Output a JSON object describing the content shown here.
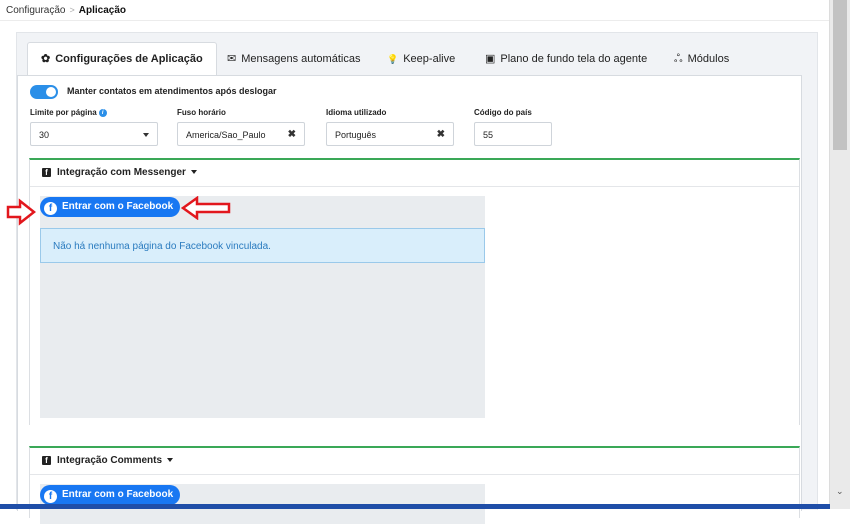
{
  "breadcrumb": {
    "parent": "Configuração",
    "current": "Aplicação"
  },
  "tabs": [
    {
      "label": "Configurações de Aplicação",
      "icon": "gear-icon",
      "glyph": "✿",
      "active": true
    },
    {
      "label": "Mensagens automáticas",
      "icon": "envelope-icon",
      "glyph": "✉"
    },
    {
      "label": "Keep-alive",
      "icon": "lightbulb-icon",
      "glyph": "💡"
    },
    {
      "label": "Plano de fundo tela do agente",
      "icon": "image-icon",
      "glyph": "▣"
    },
    {
      "label": "Módulos",
      "icon": "modules-icon",
      "glyph": "ஃ"
    }
  ],
  "settings": {
    "keep_contacts_label": "Manter contatos em atendimentos após deslogar",
    "keep_contacts_on": true,
    "page_limit": {
      "label": "Limite por página",
      "value": "30"
    },
    "timezone": {
      "label": "Fuso horário",
      "value": "America/Sao_Paulo"
    },
    "language": {
      "label": "Idioma utilizado",
      "value": "Português"
    },
    "country_code": {
      "label": "Código do país",
      "value": "55"
    }
  },
  "messenger": {
    "title": "Integração com Messenger",
    "login_button": "Entrar com o Facebook",
    "empty_message": "Não há nenhuma página do Facebook vinculada."
  },
  "comments": {
    "title": "Integração Comments",
    "login_button": "Entrar com o Facebook"
  },
  "colors": {
    "facebook_blue": "#1877f2",
    "toggle_blue": "#2b8fe8",
    "card_accent_green": "#3aa857",
    "annotation_red": "#e2171d"
  }
}
